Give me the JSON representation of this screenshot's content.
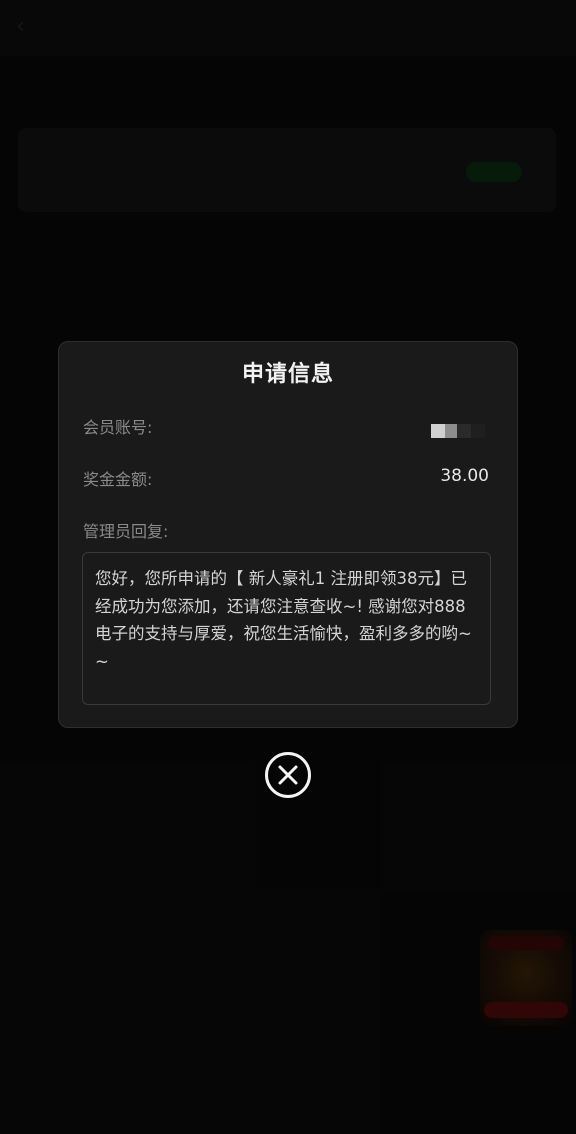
{
  "underlying_page": {
    "back_icon": "chevron-left-icon"
  },
  "dialog": {
    "title": "申请信息",
    "member_account_label": "会员账号:",
    "member_account_value_masked": true,
    "bonus_amount_label": "奖金金额:",
    "bonus_amount_value": "38.00",
    "admin_reply_label": "管理员回复:",
    "admin_reply_text": "您好，您所申请的【 新人豪礼1 注册即领38元】已经成功为您添加，还请您注意查收~! 感谢您对888电子的支持与厚爱，祝您生活愉快，盈利多多的哟~~"
  },
  "close_button": {
    "icon": "close-circle-icon"
  },
  "colors": {
    "background": "#070707",
    "dialog_bg": "#1a1a1a",
    "dialog_border": "#2e2e2e",
    "label_text": "#8a8a8a",
    "value_text": "#e6e6e6",
    "close_icon": "#f4f4f4"
  }
}
